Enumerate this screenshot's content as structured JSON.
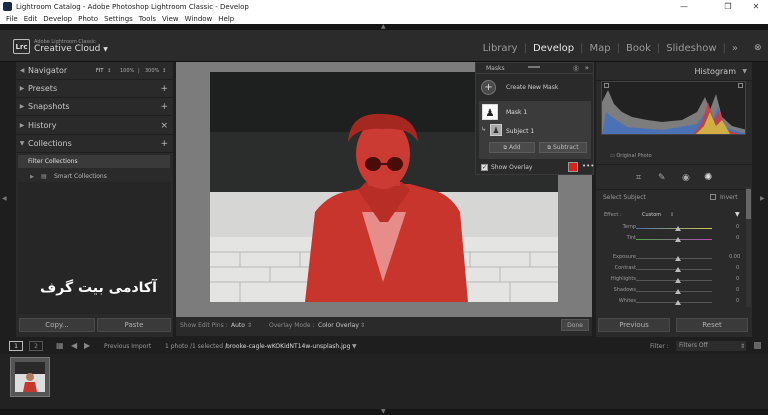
{
  "window": {
    "title": "Lightroom Catalog - Adobe Photoshop Lightroom Classic - Develop"
  },
  "menu": [
    "File",
    "Edit",
    "Develop",
    "Photo",
    "Settings",
    "Tools",
    "View",
    "Window",
    "Help"
  ],
  "identity": {
    "logo": "Lrc",
    "line1": "Adobe Lightroom Classic",
    "line2": "Creative Cloud"
  },
  "modules": [
    {
      "label": "Library",
      "active": false
    },
    {
      "label": "Develop",
      "active": true
    },
    {
      "label": "Map",
      "active": false
    },
    {
      "label": "Book",
      "active": false
    },
    {
      "label": "Slideshow",
      "active": false
    }
  ],
  "left_panel": {
    "navigator": {
      "label": "Navigator",
      "opts": [
        "FIT",
        "100%",
        "300%"
      ]
    },
    "sections": [
      {
        "label": "Presets",
        "action": "+"
      },
      {
        "label": "Snapshots",
        "action": "+"
      },
      {
        "label": "History",
        "action": "×"
      },
      {
        "label": "Collections",
        "action": "+"
      }
    ],
    "collections": [
      {
        "label": "Filter Collections"
      },
      {
        "label": "Smart Collections"
      }
    ],
    "copy": "Copy...",
    "paste": "Paste"
  },
  "watermark": "آکادمی بیت گرف",
  "toolbar": {
    "show_edit_pins_label": "Show Edit Pins :",
    "show_edit_pins_value": "Auto",
    "overlay_mode_label": "Overlay Mode :",
    "overlay_mode_value": "Color Overlay",
    "done": "Done"
  },
  "masks": {
    "title": "Masks",
    "create": "Create New Mask",
    "mask1": "Mask 1",
    "subject": "Subject 1",
    "add": "Add",
    "subtract": "Subtract",
    "show_overlay": "Show Overlay",
    "overlay_color": "#d8241c"
  },
  "right_panel": {
    "histogram": "Histogram",
    "original_photo": "Original Photo",
    "select_subject": "Select Subject",
    "invert": "Invert",
    "effect_label": "Effect :",
    "effect_value": "Custom",
    "sliders": [
      {
        "label": "Temp",
        "value": "0",
        "pos": 0.5
      },
      {
        "label": "Tint",
        "value": "0",
        "pos": 0.5
      },
      {
        "label": "Exposure",
        "value": "0.00",
        "pos": 0.5
      },
      {
        "label": "Contrast",
        "value": "0",
        "pos": 0.5
      },
      {
        "label": "Highlights",
        "value": "0",
        "pos": 0.5
      },
      {
        "label": "Shadows",
        "value": "0",
        "pos": 0.5
      },
      {
        "label": "Whites",
        "value": "0",
        "pos": 0.5
      }
    ],
    "previous": "Previous",
    "reset": "Reset"
  },
  "filmstrip": {
    "page1": "1",
    "page2": "2",
    "source": "Previous Import",
    "count": "1 photo /1 selected /",
    "filename": "brooke-cagle-wKOKidNT14w-unsplash.jpg",
    "filter_label": "Filter :",
    "filter_value": "Filters Off"
  }
}
